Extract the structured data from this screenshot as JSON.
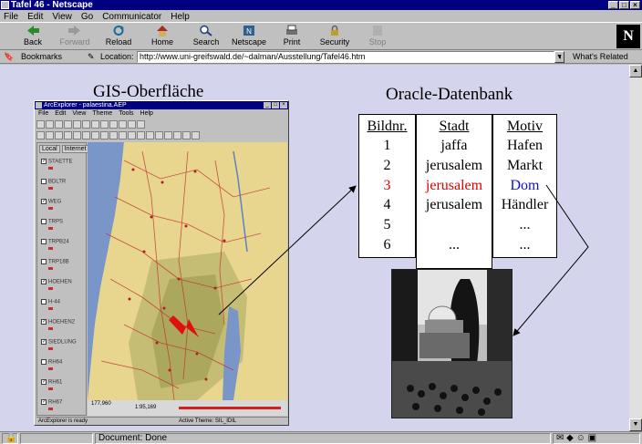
{
  "window": {
    "title": "Tafel 46 - Netscape"
  },
  "menu": [
    "File",
    "Edit",
    "View",
    "Go",
    "Communicator",
    "Help"
  ],
  "toolbar": [
    {
      "label": "Back",
      "icon": "back-arrow-icon",
      "enabled": true
    },
    {
      "label": "Forward",
      "icon": "forward-arrow-icon",
      "enabled": false
    },
    {
      "label": "Reload",
      "icon": "reload-icon",
      "enabled": true
    },
    {
      "label": "Home",
      "icon": "home-icon",
      "enabled": true
    },
    {
      "label": "Search",
      "icon": "search-icon",
      "enabled": true
    },
    {
      "label": "Netscape",
      "icon": "netscape-icon",
      "enabled": true
    },
    {
      "label": "Print",
      "icon": "print-icon",
      "enabled": true
    },
    {
      "label": "Security",
      "icon": "security-lock-icon",
      "enabled": true
    },
    {
      "label": "Stop",
      "icon": "stop-icon",
      "enabled": false
    }
  ],
  "logo": "N",
  "locationbar": {
    "bookmarks_label": "Bookmarks",
    "location_label": "Location:",
    "url": "http://www.uni-greifswald.de/~dalman/Ausstellung/Tafel46.htm",
    "whats_related": "What's Related"
  },
  "slide": {
    "gis_heading": "GIS-Oberfläche",
    "oracle_heading": "Oracle-Datenbank"
  },
  "arcexplorer": {
    "title": "ArcExplorer - palaestina.AEP",
    "menu": [
      "File",
      "Edit",
      "View",
      "Theme",
      "Tools",
      "Help"
    ],
    "tabs": [
      "Local",
      "Internet"
    ],
    "layers": [
      "STAETTE",
      "BDLTR",
      "WEG",
      "TRPS",
      "TRPB24",
      "TRP18B",
      "HOEHEN",
      "H-44",
      "HOEHEN2",
      "SIEDLUNG",
      "RH64",
      "RH61",
      "RH67"
    ],
    "scale_text": "1:95,169",
    "coords_text": "177,960",
    "status_left": "ArcExplorer is ready",
    "status_right": "Active Theme: SIL_IDIL"
  },
  "table": {
    "headers": [
      "Bildnr.",
      "Stadt",
      "Motiv"
    ],
    "bildnr": [
      "1",
      "2",
      "3",
      "4",
      "5",
      "6"
    ],
    "stadt": [
      "jaffa",
      "jerusalem",
      "jerusalem",
      "jerusalem",
      "",
      "..."
    ],
    "motiv": [
      "Hafen",
      "Markt",
      "Dom",
      "Händler",
      "...",
      "..."
    ],
    "highlight_red_row": 3,
    "highlight_blue": "Dom"
  },
  "status": {
    "text": "Document: Done"
  },
  "colors": {
    "titlebar": "#000080",
    "content_bg": "#d4d4ec",
    "highlight_red": "#e00000",
    "highlight_blue": "#1010d0"
  }
}
